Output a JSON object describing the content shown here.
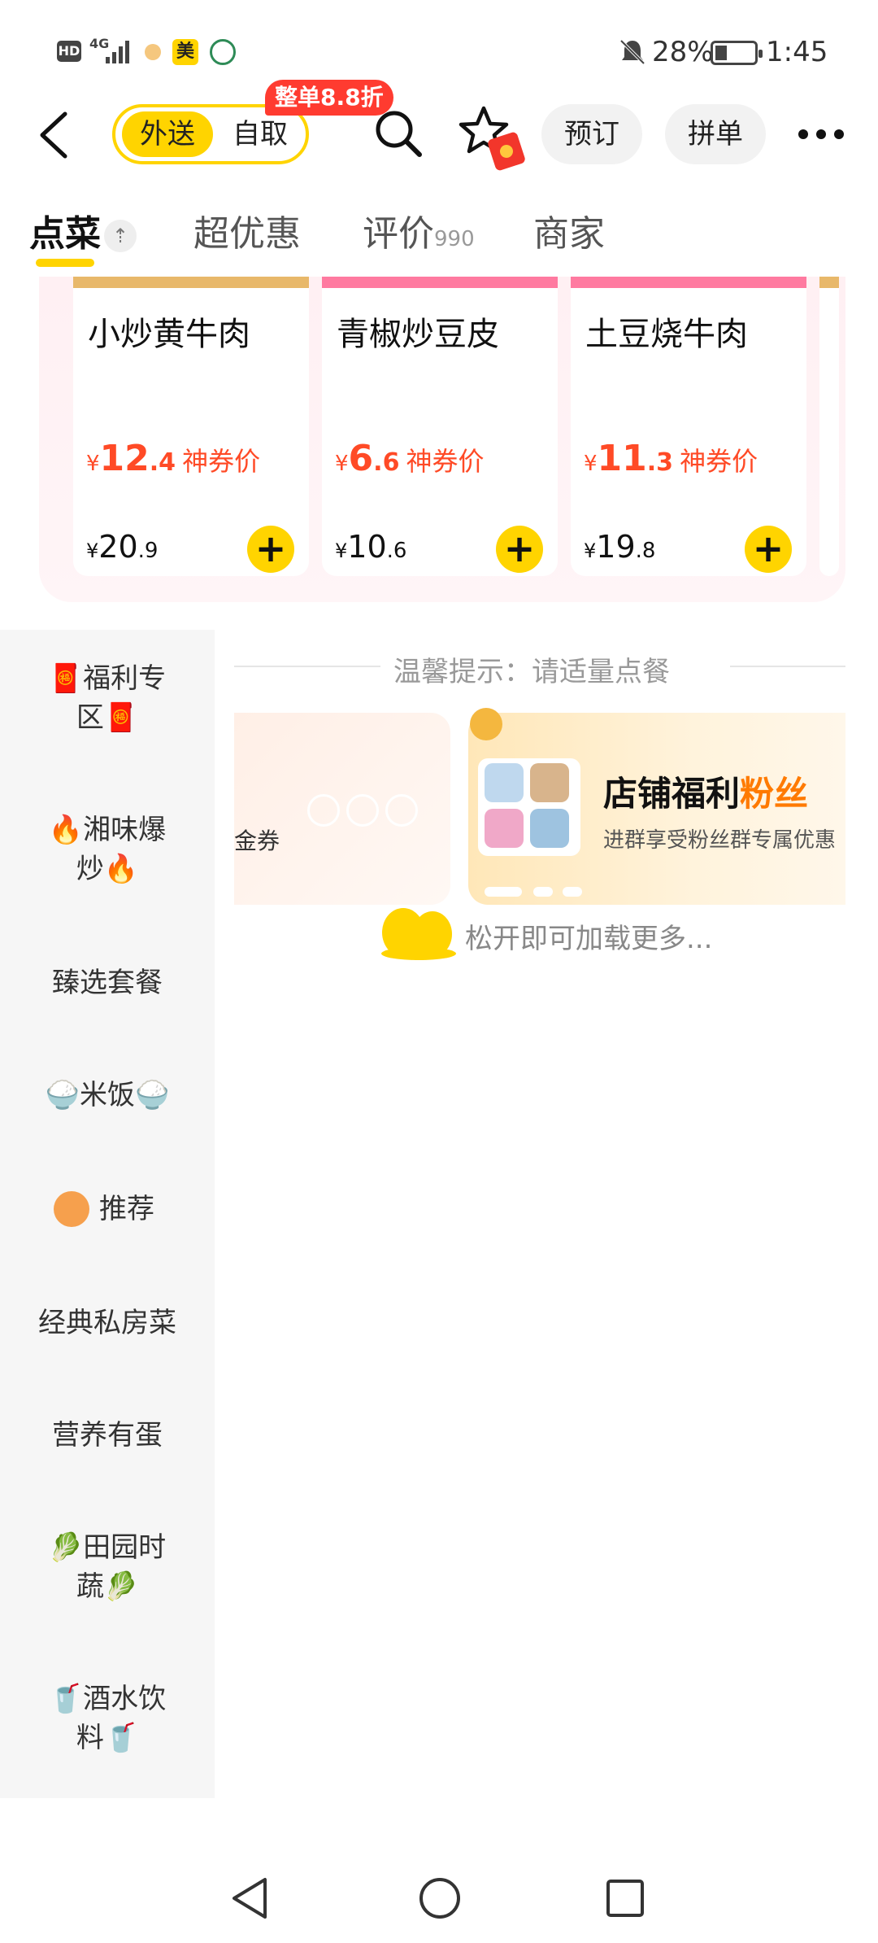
{
  "status_bar": {
    "hd": "HD",
    "network": "4G",
    "meituan_badge": "美",
    "battery_percent": "28%",
    "time": "1:45"
  },
  "header": {
    "delivery_label": "外送",
    "pickup_label": "自取",
    "promo_tag": "整单8.8折",
    "reserve_label": "预订",
    "group_label": "拼单",
    "icons": [
      "back-icon",
      "search-icon",
      "star-icon",
      "redpacket-icon",
      "more-icon"
    ]
  },
  "tabs": [
    {
      "label": "点菜",
      "active": true
    },
    {
      "label": "超优惠",
      "active": false
    },
    {
      "label": "评价",
      "count": "990",
      "active": false
    },
    {
      "label": "商家",
      "active": false
    }
  ],
  "dishes": [
    {
      "name": "小炒黄牛肉",
      "price_sym": "¥",
      "price_int": "12",
      "price_dec": ".4",
      "price_label": "神券价",
      "orig_sym": "¥",
      "orig_int": "20",
      "orig_dec": ".9"
    },
    {
      "name": "青椒炒豆皮",
      "price_sym": "¥",
      "price_int": "6",
      "price_dec": ".6",
      "price_label": "神券价",
      "orig_sym": "¥",
      "orig_int": "10",
      "orig_dec": ".6"
    },
    {
      "name": "土豆烧牛肉",
      "price_sym": "¥",
      "price_int": "11",
      "price_dec": ".3",
      "price_label": "神券价",
      "orig_sym": "¥",
      "orig_int": "19",
      "orig_dec": ".8"
    }
  ],
  "categories": [
    {
      "line1": "🧧福利专",
      "line2": "区🧧"
    },
    {
      "line1": "🔥湘味爆",
      "line2": "炒🔥"
    },
    {
      "line1": "臻选套餐",
      "line2": ""
    },
    {
      "line1": "🍚米饭🍚",
      "line2": ""
    },
    {
      "line1": "推荐",
      "line2": ""
    },
    {
      "line1": "经典私房菜",
      "line2": ""
    },
    {
      "line1": "营养有蛋",
      "line2": ""
    },
    {
      "line1": "🥬田园时",
      "line2": "蔬🥬"
    },
    {
      "line1": "🥤酒水饮",
      "line2": "料🥤"
    }
  ],
  "main": {
    "tip": "温馨提示：请适量点餐",
    "coupon_partial": "金券",
    "banner_title_a": "店铺福利",
    "banner_title_b": "粉丝",
    "banner_sub": "进群享受粉丝群专属优惠",
    "load_more": "松开即可加载更多..."
  },
  "colors": {
    "accent_yellow": "#FFD400",
    "price_red": "#FF4A26",
    "promo_red": "#FF3B30"
  }
}
